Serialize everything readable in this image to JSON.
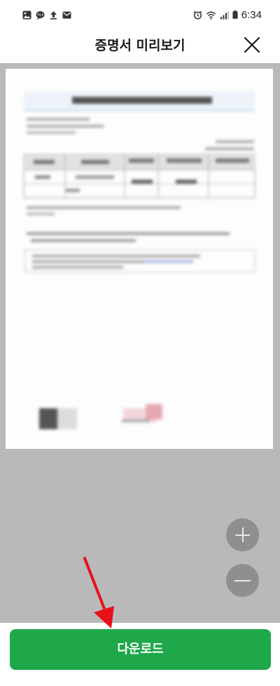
{
  "status_bar": {
    "time": "6:34",
    "left_icons": [
      "gallery-icon",
      "chat-icon",
      "upload-icon",
      "mail-icon"
    ],
    "right_icons": [
      "alarm-icon",
      "wifi-icon",
      "signal-icon",
      "battery-icon"
    ]
  },
  "header": {
    "title": "증명서 미리보기",
    "close_icon": "close-icon"
  },
  "preview": {
    "zoom_in_icon": "plus-icon",
    "zoom_out_icon": "minus-icon"
  },
  "download": {
    "label": "다운로드"
  },
  "colors": {
    "accent": "#1ea84a",
    "preview_bg": "#b9b9b9",
    "zoom_button": "#8f8f8f",
    "annotation": "#e8101a"
  }
}
